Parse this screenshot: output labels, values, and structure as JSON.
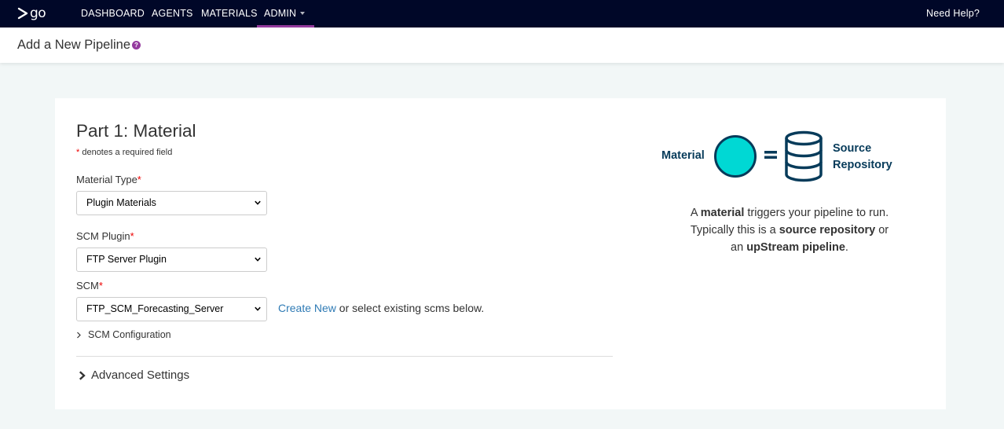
{
  "nav": {
    "logo_text": "go",
    "items": [
      "DASHBOARD",
      "AGENTS",
      "MATERIALS",
      "ADMIN"
    ],
    "help": "Need Help?",
    "active_color": "#943a9e",
    "bg_color": "#000728"
  },
  "header": {
    "title": "Add a New Pipeline",
    "help_icon": "?"
  },
  "form": {
    "part_title": "Part 1: Material",
    "required_star": "*",
    "required_note": " denotes a required field",
    "material_type_label": "Material Type",
    "material_type_value": "Plugin Materials",
    "scm_plugin_label": "SCM Plugin",
    "scm_plugin_value": "FTP Server Plugin",
    "scm_label": "SCM",
    "scm_value": "FTP_SCM_Forecasting_Server",
    "create_new": "Create New",
    "create_suffix": " or select existing scms below.",
    "scm_config": "SCM Configuration",
    "advanced": "Advanced Settings"
  },
  "illustration": {
    "material": "Material",
    "source_line1": "Source",
    "source_line2": "Repository",
    "circle_color": "#00d8d4",
    "stroke_color": "#073b5a"
  },
  "description": {
    "p1": "A ",
    "b1": "material",
    "p2": " triggers your pipeline to run.",
    "p3": "Typically this is a ",
    "b2": "source repository",
    "p4": " or",
    "p5": "an ",
    "b3": "upStream pipeline",
    "p6": "."
  }
}
